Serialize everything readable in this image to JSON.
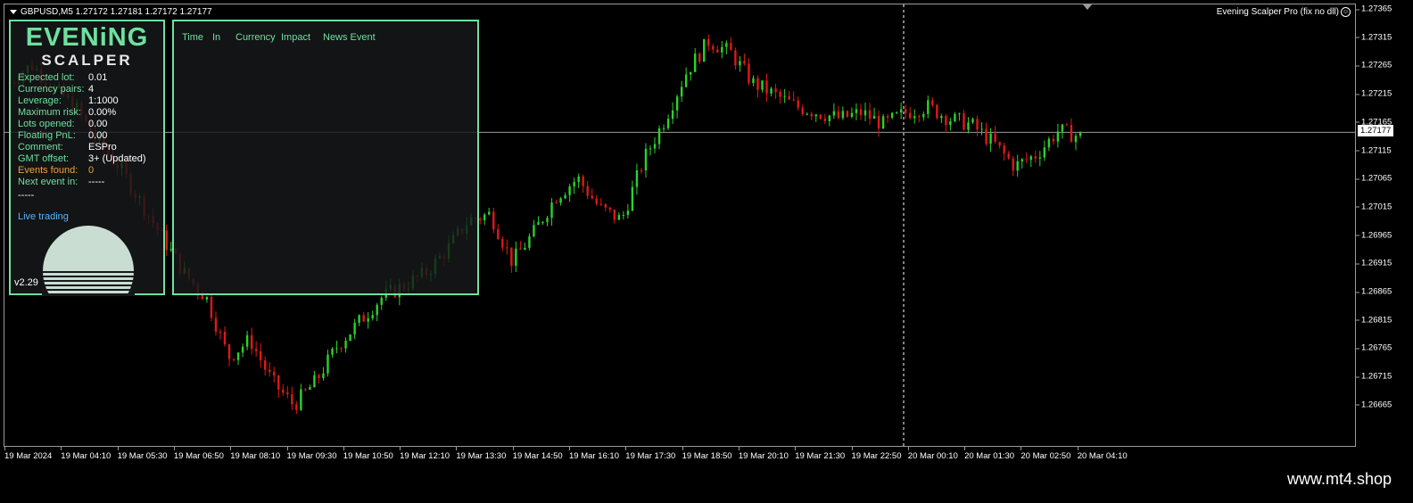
{
  "chart": {
    "header": "GBPUSD,M5  1.27172 1.27181 1.27172 1.27177",
    "ea_label": "Evening Scalper Pro (fix no dll)",
    "current_price": "1.27177",
    "colors": {
      "bull": "#2bd22b",
      "bear": "#e01818",
      "crosshair": "#ffffff",
      "frame": "#9a9a9a"
    },
    "price_ticks": [
      "1.27365",
      "1.27315",
      "1.27265",
      "1.27215",
      "1.27165",
      "1.27115",
      "1.27065",
      "1.27015",
      "1.26965",
      "1.26915",
      "1.26865",
      "1.26815",
      "1.26765",
      "1.26715",
      "1.26665"
    ],
    "time_ticks": [
      "19 Mar 2024",
      "19 Mar 04:10",
      "19 Mar 05:30",
      "19 Mar 06:50",
      "19 Mar 08:10",
      "19 Mar 09:30",
      "19 Mar 10:50",
      "19 Mar 12:10",
      "19 Mar 13:30",
      "19 Mar 14:50",
      "19 Mar 16:10",
      "19 Mar 17:30",
      "19 Mar 18:50",
      "19 Mar 20:10",
      "19 Mar 21:30",
      "19 Mar 22:50",
      "20 Mar 00:10",
      "20 Mar 01:30",
      "20 Mar 02:50",
      "20 Mar 04:10"
    ],
    "price_range": [
      1.2665,
      1.2738
    ],
    "approx_closes": [
      1.2726,
      1.2729,
      1.2725,
      1.2722,
      1.2716,
      1.2712,
      1.2706,
      1.27,
      1.2694,
      1.269,
      1.268,
      1.2683,
      1.2676,
      1.2672,
      1.2676,
      1.2682,
      1.2686,
      1.269,
      1.2692,
      1.2694,
      1.2698,
      1.2703,
      1.2704,
      1.2696,
      1.2701,
      1.2707,
      1.271,
      1.2705,
      1.2703,
      1.2713,
      1.272,
      1.2728,
      1.2733,
      1.2731,
      1.2726,
      1.2724,
      1.2722,
      1.2721,
      1.272,
      1.2721,
      1.2719,
      1.2721,
      1.2722,
      1.272,
      1.2719,
      1.2716,
      1.2712,
      1.2714,
      1.2718,
      1.2717
    ]
  },
  "ea_panel": {
    "brand_top": "EVENiNG",
    "brand_bottom": "SCALPER",
    "rows": [
      {
        "label": "Expected lot:",
        "value": "0.01"
      },
      {
        "label": "Currency pairs:",
        "value": "4"
      },
      {
        "label": "Leverage:",
        "value": "1:1000"
      },
      {
        "label": "Maximum risk:",
        "value": "0.00%"
      },
      {
        "label": "Lots opened:",
        "value": "0.00"
      },
      {
        "label": "Floating PnL:",
        "value": "0.00"
      },
      {
        "label": "Comment:",
        "value": "ESPro"
      },
      {
        "label": "GMT offset:",
        "value": "3+ (Updated)"
      },
      {
        "label": "Events found:",
        "value": "0"
      },
      {
        "label": "Next event in:",
        "value": "-----"
      }
    ],
    "dashes": "-----",
    "live_trading": "Live trading",
    "version": "v2.29"
  },
  "news_panel": {
    "columns": [
      "Time",
      "In",
      "Currency",
      "Impact",
      "News Event"
    ]
  },
  "footer": {
    "watermark": "www.mt4.shop"
  }
}
